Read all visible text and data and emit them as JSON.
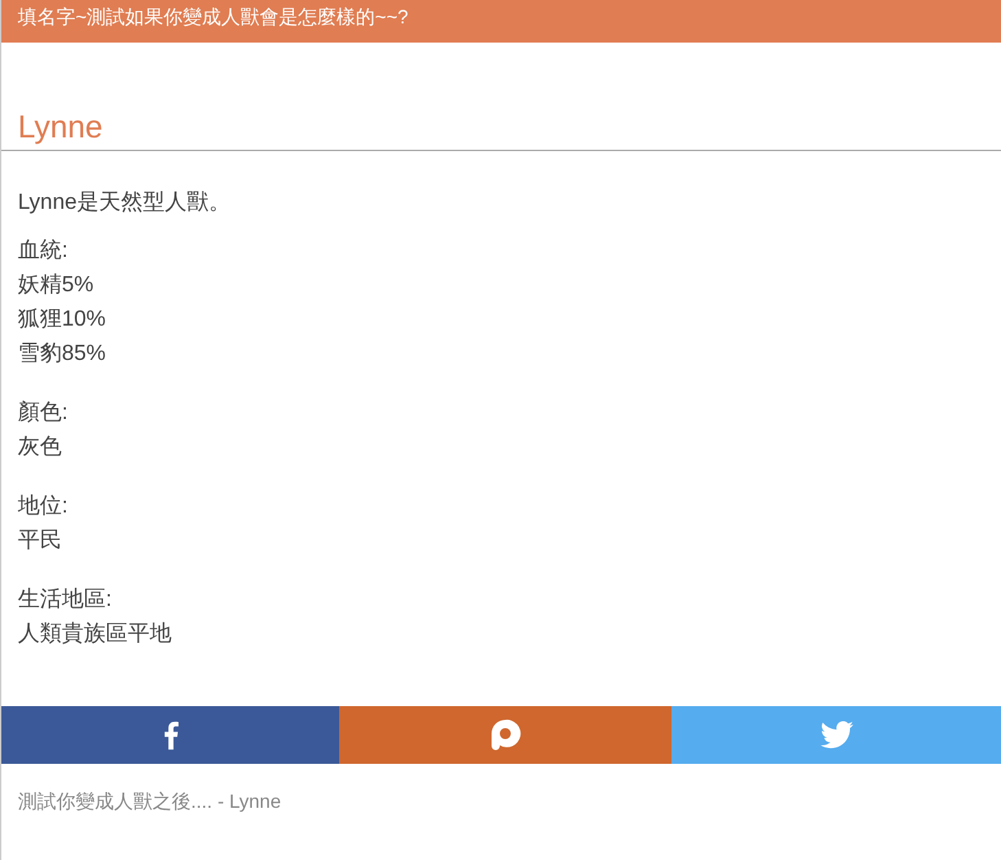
{
  "header": {
    "title": "填名字~測試如果你變成人獸會是怎麼樣的~~?"
  },
  "result": {
    "name": "Lynne",
    "intro": "Lynne是天然型人獸。",
    "sections": [
      {
        "label": "血統:",
        "lines": [
          "妖精5%",
          "狐狸10%",
          "雪豹85%"
        ]
      },
      {
        "label": "顏色:",
        "lines": [
          "灰色"
        ]
      },
      {
        "label": "地位:",
        "lines": [
          "平民"
        ]
      },
      {
        "label": "生活地區:",
        "lines": [
          "人類貴族區平地"
        ]
      }
    ]
  },
  "share": [
    {
      "kind": "facebook"
    },
    {
      "kind": "plurk"
    },
    {
      "kind": "twitter"
    }
  ],
  "footer": {
    "caption": "測試你變成人獸之後.... - Lynne"
  }
}
